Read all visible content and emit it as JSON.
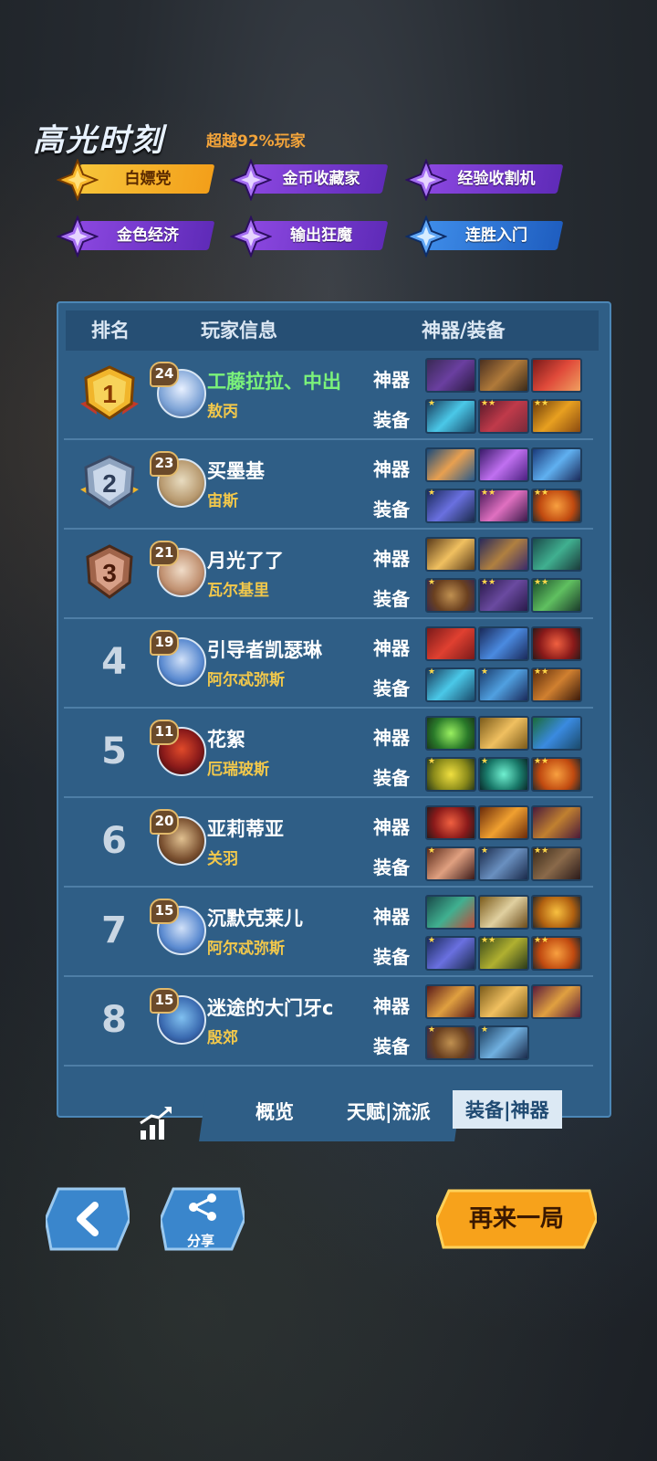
{
  "highlight": {
    "title": "高光时刻",
    "subtitle": "超越92%玩家",
    "badges": [
      {
        "label": "白嫖党",
        "style": "gold"
      },
      {
        "label": "金币收藏家",
        "style": "purple"
      },
      {
        "label": "经验收割机",
        "style": "purple"
      },
      {
        "label": "金色经济",
        "style": "purple"
      },
      {
        "label": "输出狂魔",
        "style": "purple"
      },
      {
        "label": "连胜入门",
        "style": "blue"
      }
    ]
  },
  "table": {
    "headers": {
      "rank": "排名",
      "player": "玩家信息",
      "gear": "神器/装备"
    },
    "artifact_label": "神器",
    "equip_label": "装备",
    "rows": [
      {
        "rank": "1",
        "level": "24",
        "name": "工藤拉拉、中出",
        "hero": "敖丙"
      },
      {
        "rank": "2",
        "level": "23",
        "name": "买墨基",
        "hero": "宙斯"
      },
      {
        "rank": "3",
        "level": "21",
        "name": "月光了了",
        "hero": "瓦尔基里"
      },
      {
        "rank": "4",
        "level": "19",
        "name": "引导者凯瑟琳",
        "hero": "阿尔忒弥斯"
      },
      {
        "rank": "5",
        "level": "11",
        "name": "花絮",
        "hero": "厄瑞玻斯"
      },
      {
        "rank": "6",
        "level": "20",
        "name": "亚莉蒂亚",
        "hero": "关羽"
      },
      {
        "rank": "7",
        "level": "15",
        "name": "沉默克莱儿",
        "hero": "阿尔忒弥斯"
      },
      {
        "rank": "8",
        "level": "15",
        "name": "迷途的大门牙c",
        "hero": "殷郊"
      }
    ]
  },
  "tabs": {
    "overview": "概览",
    "talent": "天赋|流派",
    "gear": "装备|神器"
  },
  "buttons": {
    "share": "分享",
    "play_again": "再来一局"
  },
  "colors": {
    "panel": "#2f5e86",
    "accent_gold": "#f7a21b",
    "hero_name": "#f2c84b",
    "player_green": "#7bf27a"
  }
}
